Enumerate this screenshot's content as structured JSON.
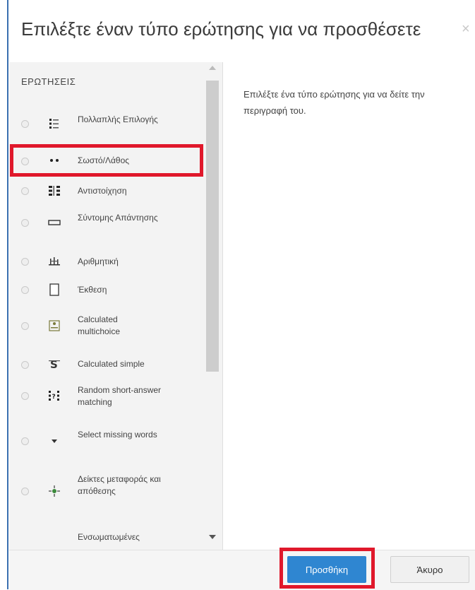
{
  "dialog": {
    "title": "Επιλέξτε έναν τύπο ερώτησης για να προσθέσετε",
    "close_icon": "close-icon"
  },
  "list": {
    "heading": "ΕΡΩΤΗΣΕΙΣ",
    "items": [
      {
        "label": "Πολλαπλής Επιλογής",
        "icon": "multichoice-icon"
      },
      {
        "label": "Σωστό/Λάθος",
        "icon": "truefalse-icon"
      },
      {
        "label": "Αντιστοίχηση",
        "icon": "match-icon"
      },
      {
        "label": "Σύντομης Απάντησης",
        "icon": "shortanswer-icon"
      },
      {
        "label": "Αριθμητική",
        "icon": "numerical-icon"
      },
      {
        "label": "Έκθεση",
        "icon": "essay-icon"
      },
      {
        "label": "Calculated multichoice",
        "icon": "calculatedmulti-icon"
      },
      {
        "label": "Calculated simple",
        "icon": "calculatedsimple-icon"
      },
      {
        "label": "Random short-answer matching",
        "icon": "randomsamatch-icon"
      },
      {
        "label": "Select missing words",
        "icon": "gapselect-icon"
      },
      {
        "label": "Δείκτες μεταφοράς και απόθεσης",
        "icon": "ddmarker-icon"
      },
      {
        "label": "Ενσωματωμένες",
        "icon": "multianswer-icon"
      }
    ],
    "selected_highlight": "Σωστό/Λάθος"
  },
  "description": {
    "text": "Επιλέξτε ένα τύπο ερώτησης για να δείτε την περιγραφή του."
  },
  "footer": {
    "add_label": "Προσθήκη",
    "cancel_label": "Άκυρο"
  },
  "colors": {
    "accent": "#2f86d1",
    "highlight": "#e0182b"
  }
}
